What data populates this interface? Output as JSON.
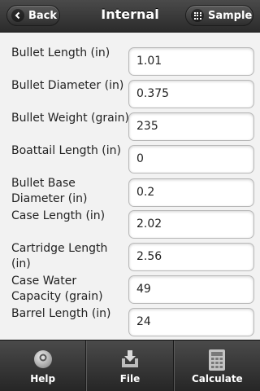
{
  "header": {
    "title": "Internal",
    "back_label": "Back",
    "sample_label": "Sample"
  },
  "fields": [
    {
      "label": "Bullet Length (in)",
      "value": "1.01"
    },
    {
      "label": "Bullet Diameter (in)",
      "value": "0.375"
    },
    {
      "label": "Bullet Weight (grain)",
      "value": "235"
    },
    {
      "label": "Boattail Length (in)",
      "value": "0"
    },
    {
      "label": "Bullet Base Diameter (in)",
      "value": "0.2"
    },
    {
      "label": "Case Length (in)",
      "value": "2.02"
    },
    {
      "label": "Cartridge Length (in)",
      "value": "2.56"
    },
    {
      "label": "Case Water Capacity (grain)",
      "value": "49"
    },
    {
      "label": "Barrel Length (in)",
      "value": "24"
    }
  ],
  "nav": {
    "help_label": "Help",
    "file_label": "File",
    "calculate_label": "Calculate"
  }
}
